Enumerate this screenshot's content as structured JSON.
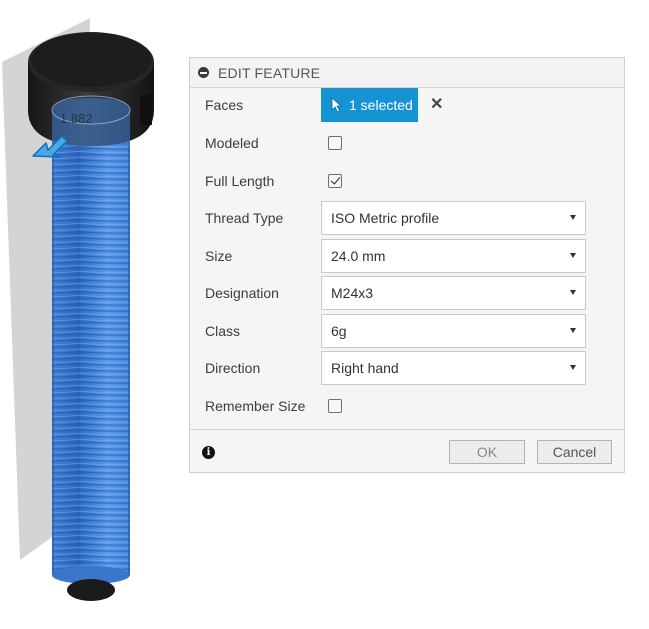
{
  "dialog": {
    "title": "EDIT FEATURE",
    "rows": {
      "faces": {
        "label": "Faces",
        "value": "1 selected"
      },
      "modeled": {
        "label": "Modeled",
        "checked": false
      },
      "full_length": {
        "label": "Full Length",
        "checked": true
      },
      "thread_type": {
        "label": "Thread Type",
        "value": "ISO Metric profile"
      },
      "size": {
        "label": "Size",
        "value": "24.0 mm"
      },
      "designation": {
        "label": "Designation",
        "value": "M24x3"
      },
      "class": {
        "label": "Class",
        "value": "6g"
      },
      "direction": {
        "label": "Direction",
        "value": "Right hand"
      },
      "remember_size": {
        "label": "Remember Size",
        "checked": false
      }
    },
    "footer": {
      "ok_label": "OK",
      "cancel_label": "Cancel",
      "info_glyph": "i"
    }
  },
  "viewport": {
    "dimension_label": "1.882"
  },
  "colors": {
    "accent": "#1593d2",
    "thread_blue": "#3f7fd6",
    "bolt_dark": "#1f1f1f"
  },
  "icons": {
    "collapse": "collapse-icon",
    "cursor": "cursor-arrow-icon",
    "clear": "close-icon",
    "info": "info-icon",
    "caret": "chevron-down-icon",
    "manipulator": "manipulator-arrow-icon"
  }
}
